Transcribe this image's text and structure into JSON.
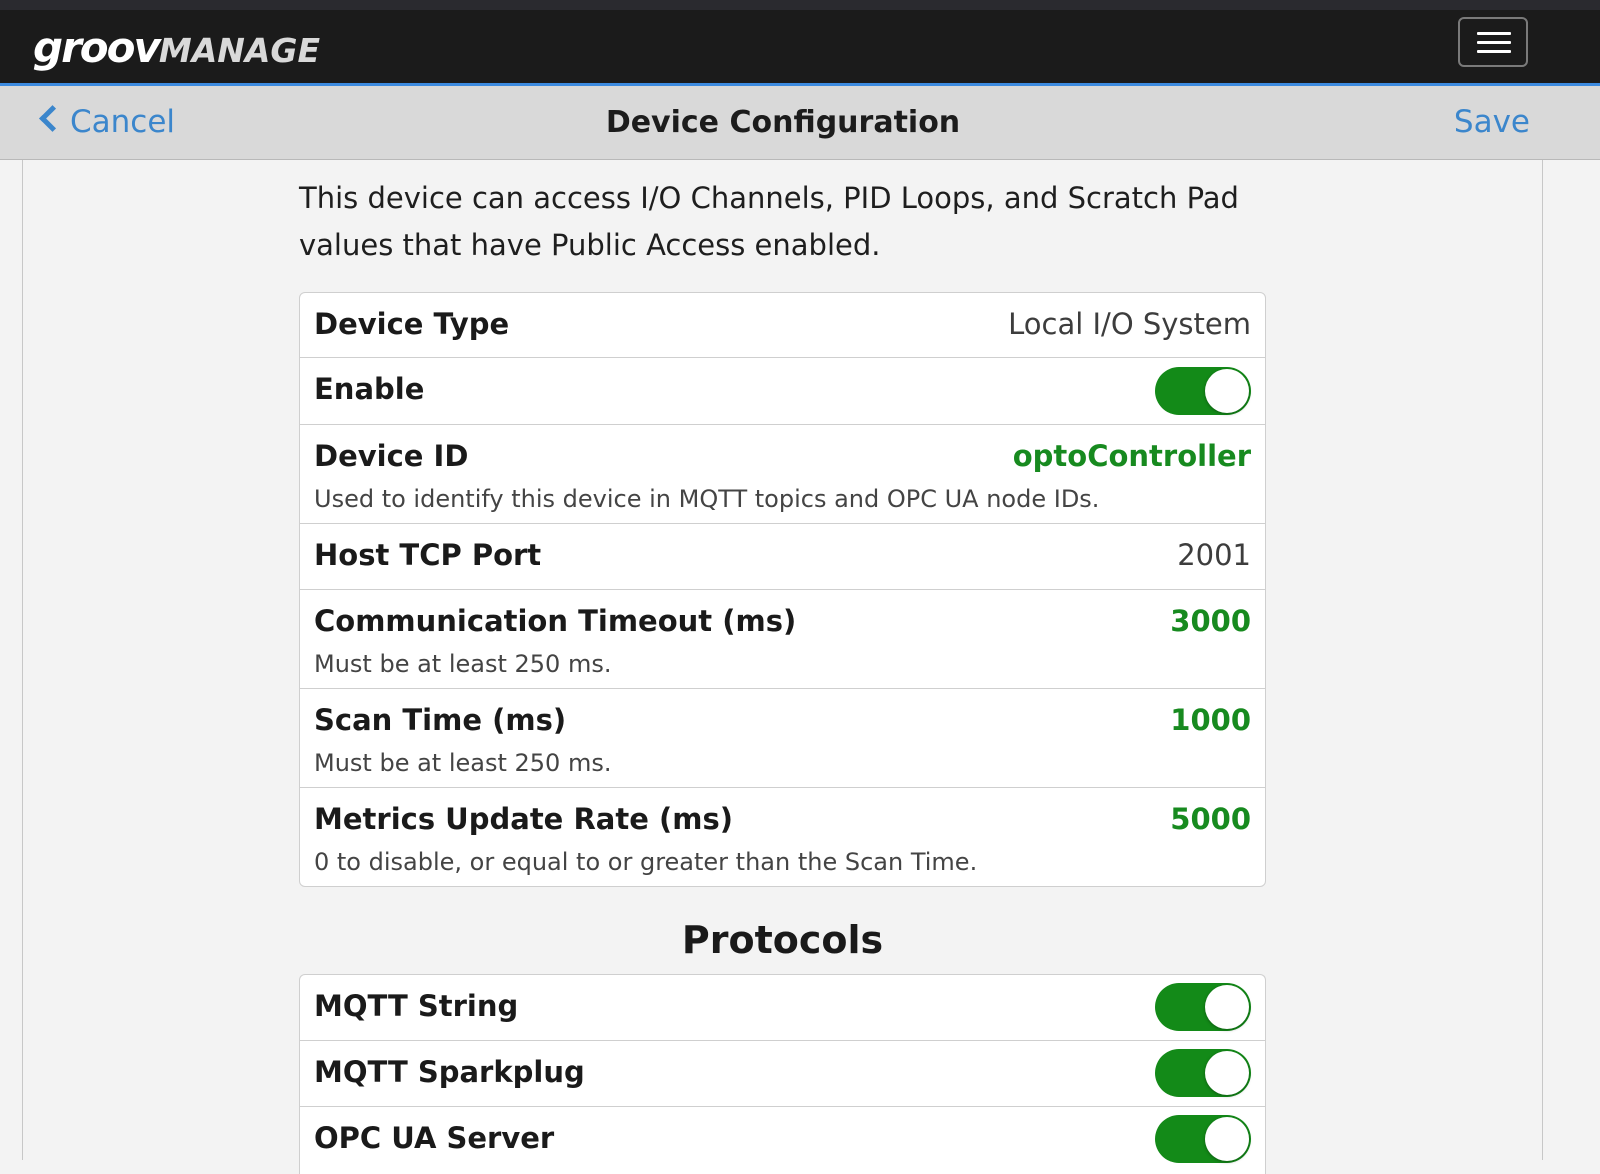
{
  "app": {
    "logo_primary": "groov",
    "logo_secondary": "MANAGE",
    "menu_icon": "hamburger-icon"
  },
  "nav": {
    "back_label": "Cancel",
    "title": "Device Configuration",
    "save_label": "Save"
  },
  "intro": "This device can access I/O Channels, PID Loops, and Scratch Pad values that have Public Access enabled.",
  "settings": [
    {
      "label": "Device Type",
      "value": "Local I/O System"
    },
    {
      "label": "Enable",
      "toggle": true
    },
    {
      "label": "Device ID",
      "value": "optoController",
      "hint": "Used to identify this device in MQTT topics and OPC UA node IDs."
    },
    {
      "label": "Host TCP Port",
      "value": "2001"
    },
    {
      "label": "Communication Timeout (ms)",
      "value": "3000",
      "hint": "Must be at least 250 ms."
    },
    {
      "label": "Scan Time (ms)",
      "value": "1000",
      "hint": "Must be at least 250 ms."
    },
    {
      "label": "Metrics Update Rate (ms)",
      "value": "5000",
      "hint": "0 to disable, or equal to or greater than the Scan Time."
    }
  ],
  "protocols": {
    "title": "Protocols",
    "items": [
      {
        "label": "MQTT String",
        "toggle": true
      },
      {
        "label": "MQTT Sparkplug",
        "toggle": true
      },
      {
        "label": "OPC UA Server",
        "toggle": true
      }
    ]
  },
  "colors": {
    "accent": "#3b86cc",
    "toggle_on": "#138a18",
    "value_green": "#178a1f",
    "appbar": "#1b1b1b",
    "navbar": "#d9d9d9"
  }
}
